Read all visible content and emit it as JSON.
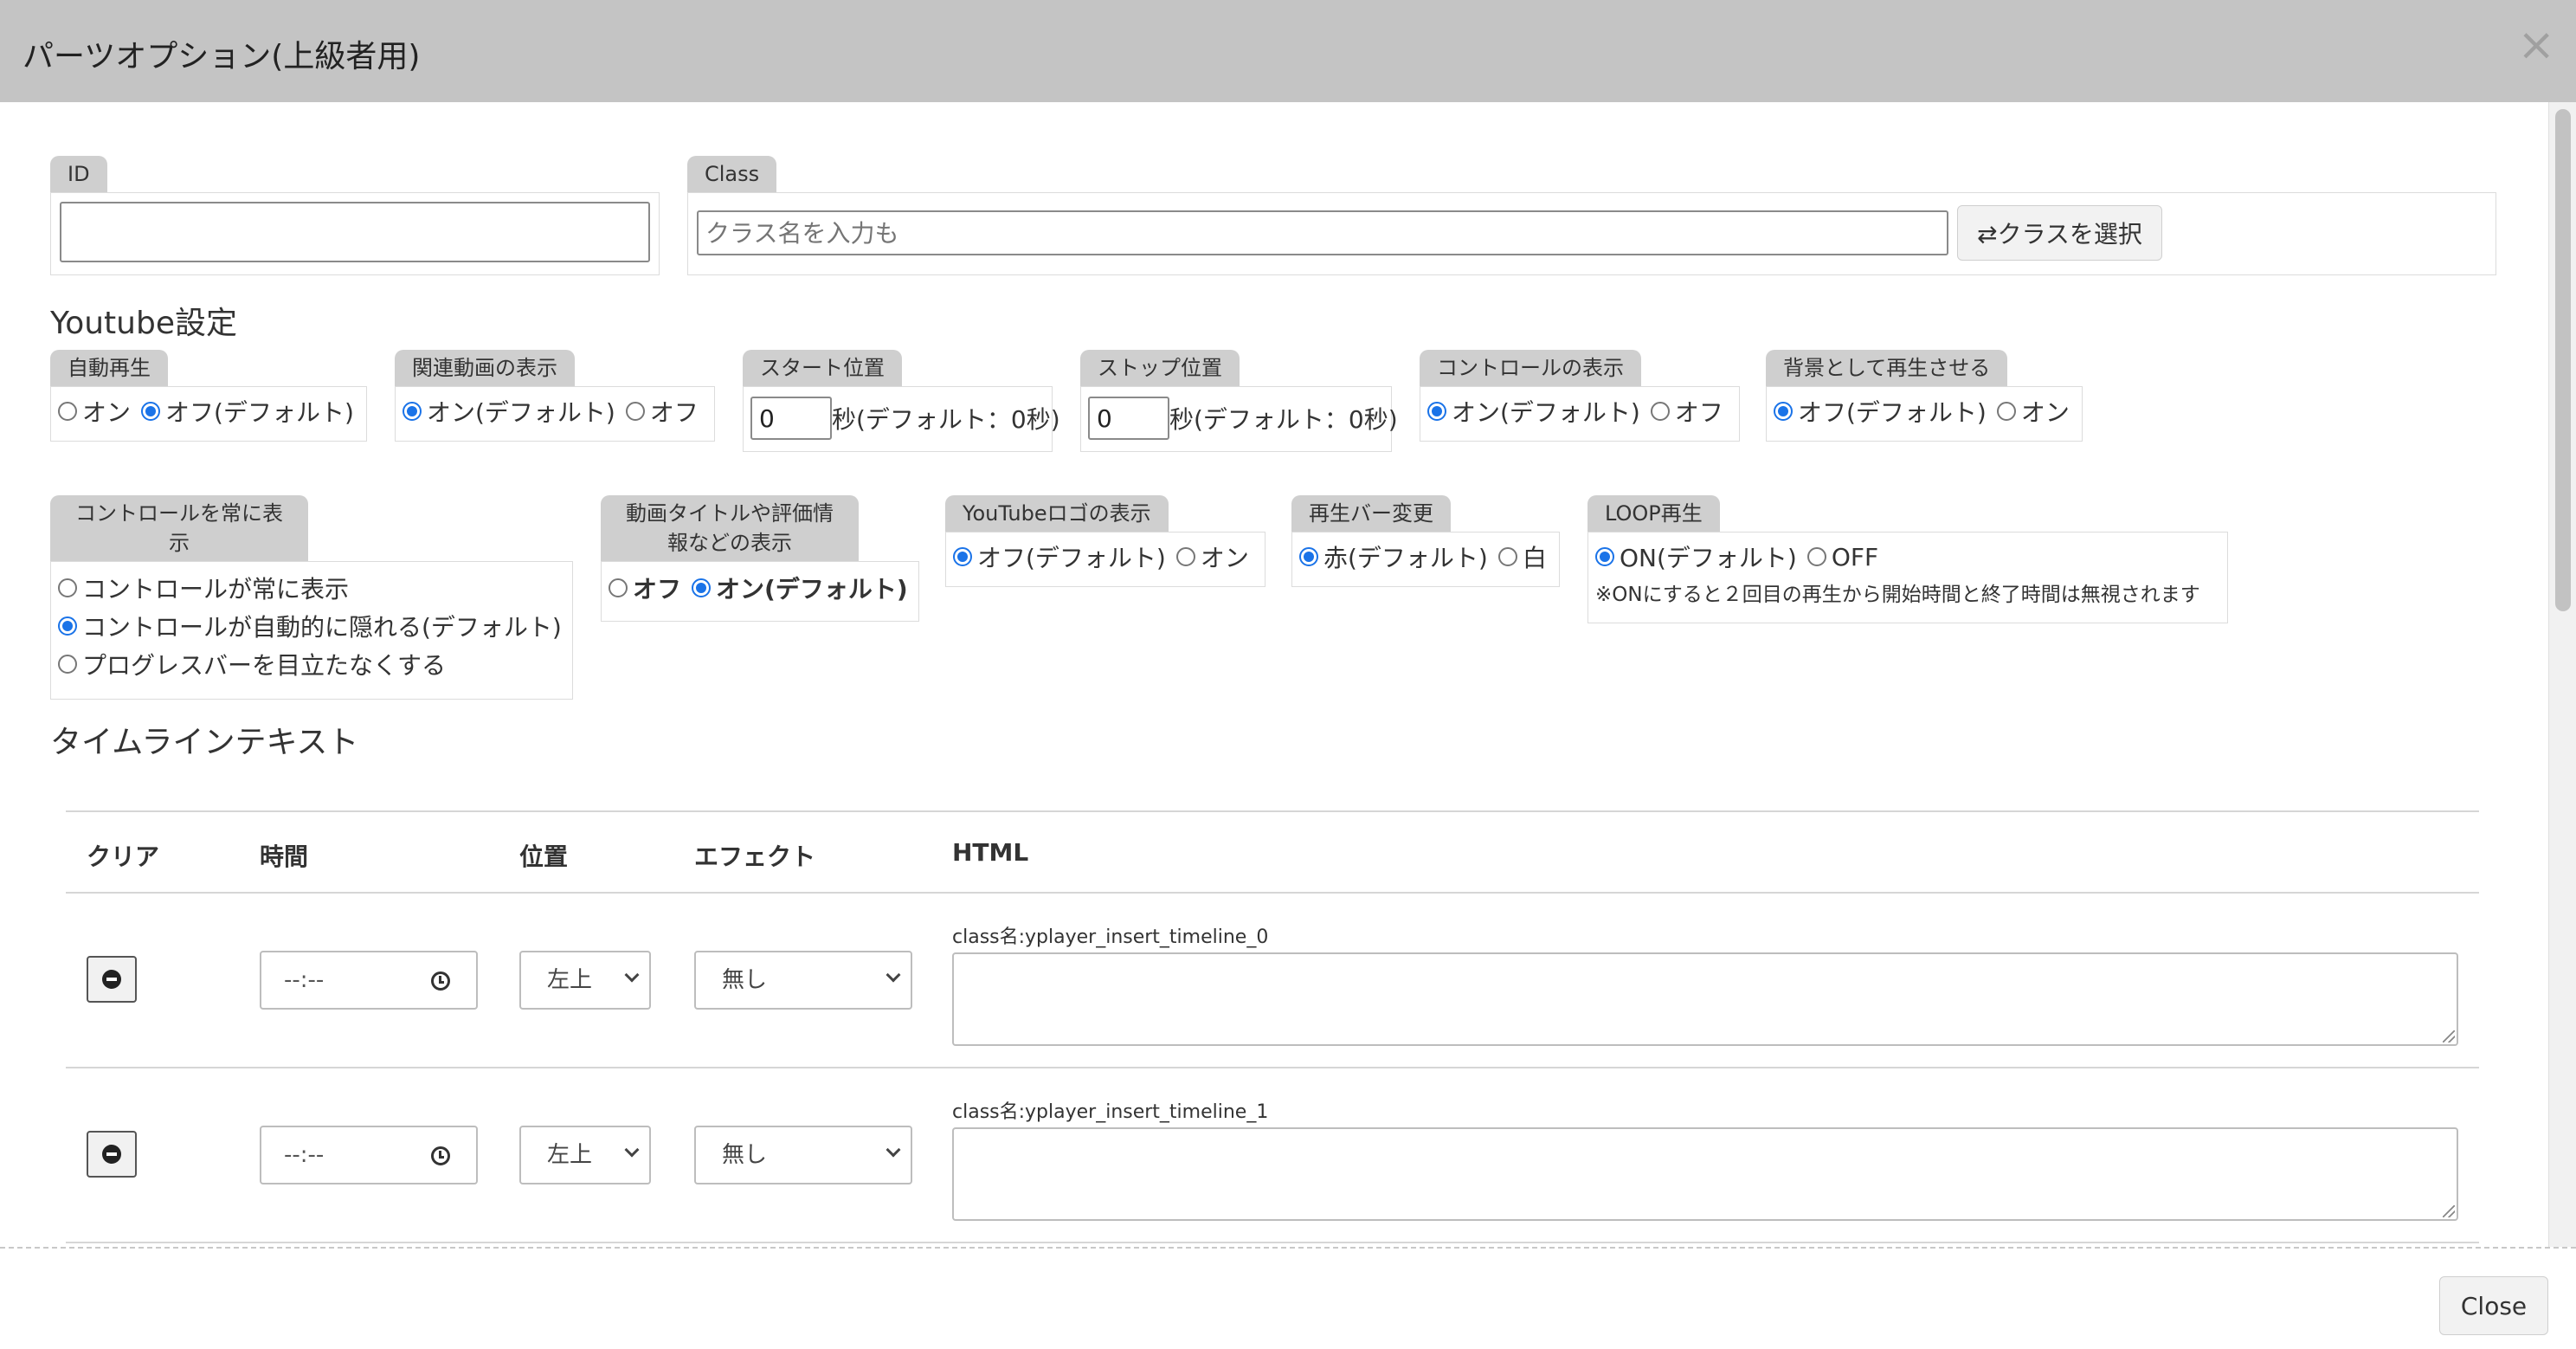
{
  "header": {
    "title": "パーツオプション(上級者用)",
    "close_symbol": "×"
  },
  "id_group": {
    "label": "ID",
    "value": ""
  },
  "class_group": {
    "label": "Class",
    "placeholder": "クラス名を入力も",
    "select_button": "⇄クラスを選択"
  },
  "youtube_section": {
    "title": "Youtube設定"
  },
  "options_row1": {
    "autoplay": {
      "label": "自動再生",
      "options": [
        "オン",
        "オフ(デフォルト)"
      ]
    },
    "related": {
      "label": "関連動画の表示",
      "options": [
        "オン(デフォルト)",
        "オフ"
      ]
    },
    "start": {
      "label": "スタート位置",
      "value": "0",
      "suffix": "秒(デフォルト：0秒)"
    },
    "stop": {
      "label": "ストップ位置",
      "value": "0",
      "suffix": "秒(デフォルト：0秒)"
    },
    "controls": {
      "label": "コントロールの表示",
      "options": [
        "オン(デフォルト)",
        "オフ"
      ]
    },
    "background": {
      "label": "背景として再生させる",
      "options": [
        "オフ(デフォルト)",
        "オン"
      ]
    }
  },
  "options_row2": {
    "always_controls": {
      "label_line1": "コントロールを常に表",
      "label_line2": "示",
      "options": [
        "コントロールが常に表示",
        "コントロールが自動的に隠れる(デフォルト)",
        "プログレスバーを目立たなくする"
      ]
    },
    "title_info": {
      "label_line1": "動画タイトルや評価情",
      "label_line2": "報などの表示",
      "options": [
        "オフ",
        "オン(デフォルト)"
      ]
    },
    "logo": {
      "label": "YouTubeロゴの表示",
      "options": [
        "オフ(デフォルト)",
        "オン"
      ]
    },
    "bar_color": {
      "label": "再生バー変更",
      "options": [
        "赤(デフォルト)",
        "白"
      ]
    },
    "loop": {
      "label": "LOOP再生",
      "options": [
        "ON(デフォルト)",
        "OFF"
      ],
      "note": "※ONにすると２回目の再生から開始時間と終了時間は無視されます"
    }
  },
  "timeline_section": {
    "title": "タイムラインテキスト"
  },
  "timeline_table": {
    "headers": [
      "クリア",
      "時間",
      "位置",
      "エフェクト",
      "HTML"
    ],
    "rows": [
      {
        "time": "--:--",
        "position": "左上",
        "effect": "無し",
        "class_label": "class名:yplayer_insert_timeline_0"
      },
      {
        "time": "--:--",
        "position": "左上",
        "effect": "無し",
        "class_label": "class名:yplayer_insert_timeline_1"
      }
    ]
  },
  "footer": {
    "close_label": "Close"
  },
  "colors": {
    "header_bg": "#c4c4c4",
    "tab_bg": "#cfcfcf",
    "radio_accent": "#1a73e8"
  }
}
